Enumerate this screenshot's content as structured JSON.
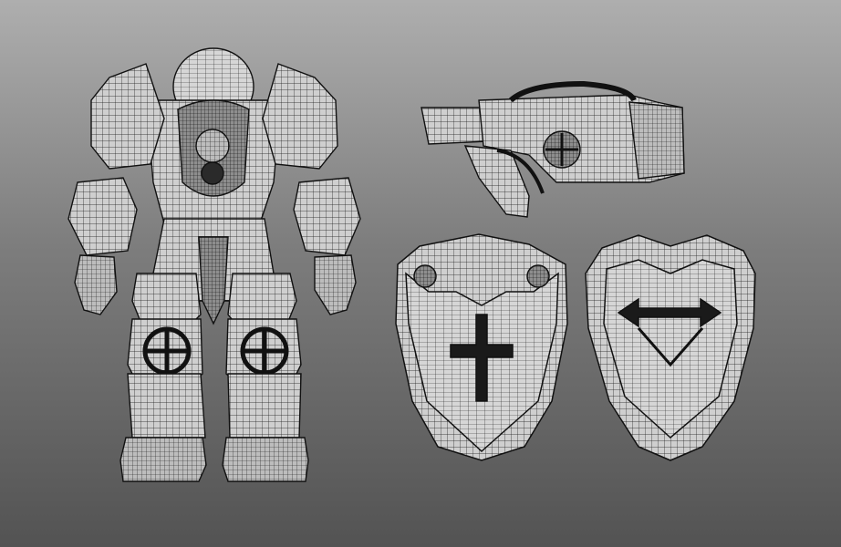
{
  "viewport": {
    "background_top": "#aeaeae",
    "background_bottom": "#535353",
    "wire_color": "#111111",
    "fill_color": "#c9c9c9",
    "shade_color": "#9c9c9c"
  },
  "objects": [
    {
      "id": "armor-suit",
      "kind": "wireframe-mesh"
    },
    {
      "id": "rifle",
      "kind": "wireframe-mesh"
    },
    {
      "id": "shield-cross",
      "kind": "wireframe-mesh"
    },
    {
      "id": "shield-arrow",
      "kind": "wireframe-mesh"
    }
  ]
}
